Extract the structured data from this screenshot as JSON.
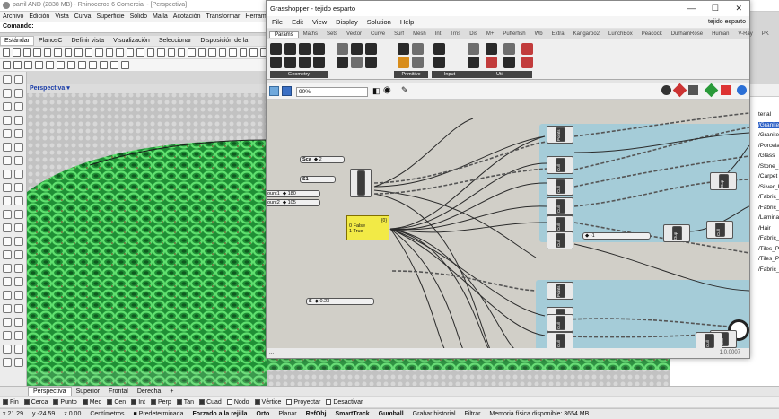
{
  "rhino": {
    "title": "parril AND (2838 MB) - Rhinoceros 6 Comercial - [Perspectiva]",
    "menu": [
      "Archivo",
      "Edición",
      "Vista",
      "Curva",
      "Superficie",
      "Sólido",
      "Malla",
      "Acotación",
      "Transformar",
      "Herramie"
    ],
    "command_label": "Comando:",
    "toolbar_tabs": [
      "Estándar",
      "PlanosC",
      "Definir vista",
      "Visualización",
      "Seleccionar",
      "Disposición de la"
    ],
    "viewport_title": "Perspectiva",
    "viewport_tabs": [
      "Perspectiva",
      "Superior",
      "Frontal",
      "Derecha"
    ],
    "osnaps": [
      {
        "label": "Fin",
        "on": true
      },
      {
        "label": "Cerca",
        "on": true
      },
      {
        "label": "Punto",
        "on": true
      },
      {
        "label": "Med",
        "on": true
      },
      {
        "label": "Cen",
        "on": true
      },
      {
        "label": "Int",
        "on": true
      },
      {
        "label": "Perp",
        "on": true
      },
      {
        "label": "Tan",
        "on": true
      },
      {
        "label": "Cuad",
        "on": true
      },
      {
        "label": "Nodo",
        "on": false
      },
      {
        "label": "Vértice",
        "on": true
      },
      {
        "label": "Proyectar",
        "on": false
      },
      {
        "label": "Desactivar",
        "on": false
      }
    ],
    "status": {
      "x": "x 21.29",
      "y": "y -24.59",
      "z": "z 0.00",
      "units": "Centímetros",
      "layer": "Predeterminada",
      "grid_snap": "Forzado a la rejilla",
      "ortho": "Orto",
      "planar": "Planar",
      "osnap": "RefObj",
      "smarttrack": "SmartTrack",
      "gumball": "Gumball",
      "history": "Grabar historial",
      "filter": "Filtrar",
      "memory": "Memoria física disponible: 3654 MB"
    },
    "right_panel_items": [
      {
        "label": "terial",
        "selected": false
      },
      {
        "label": "/Granite",
        "selected": true
      },
      {
        "label": "/Granite",
        "selected": false
      },
      {
        "label": "/Porcela",
        "selected": false
      },
      {
        "label": "/Glass",
        "selected": false
      },
      {
        "label": "/Stone_I",
        "selected": false
      },
      {
        "label": "/Carpet_",
        "selected": false
      },
      {
        "label": "/Silver_I",
        "selected": false
      },
      {
        "label": "/Fabric_I",
        "selected": false
      },
      {
        "label": "/Fabric_I",
        "selected": false
      },
      {
        "label": "/Lamina",
        "selected": false
      },
      {
        "label": "/Hair",
        "selected": false
      },
      {
        "label": "/Fabric_I",
        "selected": false
      },
      {
        "label": "/Tiles_Po",
        "selected": false
      },
      {
        "label": "/Tiles_Po",
        "selected": false
      },
      {
        "label": "/Fabric_I",
        "selected": false
      }
    ]
  },
  "grasshopper": {
    "title": "Grasshopper - tejido esparto",
    "filename": "tejido esparto",
    "menu": [
      "File",
      "Edit",
      "View",
      "Display",
      "Solution",
      "Help"
    ],
    "tabs": [
      "Params",
      "Maths",
      "Sets",
      "Vector",
      "Curve",
      "Surf",
      "Mesh",
      "Int",
      "Trns",
      "Dis",
      "M+",
      "Pufferfish",
      "Wb",
      "Extra",
      "Kangaroo2",
      "LunchBox",
      "Peacock",
      "DurhamRose",
      "Human",
      "V-Ray",
      "PK"
    ],
    "active_tab": "Params",
    "ribbon_groups": [
      "Geometry",
      "Primitive",
      "Input",
      "Util"
    ],
    "zoom": "90%",
    "version": "1.0.0007",
    "status_text": "...",
    "sliders": [
      {
        "label": "Sca",
        "value": "◆ 2"
      },
      {
        "label": "S1",
        "value": ""
      },
      {
        "label": "ount1",
        "value": "◆ 180"
      },
      {
        "label": "ount2",
        "value": "◆ 105"
      },
      {
        "label": "S",
        "value": "◆ 0.23"
      },
      {
        "label": "",
        "value": "◆ -1"
      }
    ],
    "panel": {
      "header": "{0}",
      "lines": [
        "0 False",
        "1 True"
      ]
    },
    "components": [
      "Points",
      "Cull",
      "Cull",
      "Cull",
      "Cull",
      "Cull",
      "Tree",
      "Cull",
      "Dup",
      "Dup",
      "Cull",
      "Points",
      "Cull",
      "Cull",
      "Cull",
      "Cull"
    ]
  },
  "colors": {
    "gh_group": "#9ecbdb",
    "panel": "#f2ea46",
    "knit": "#2ec44a",
    "gh_bg": "#d1cfc8"
  }
}
